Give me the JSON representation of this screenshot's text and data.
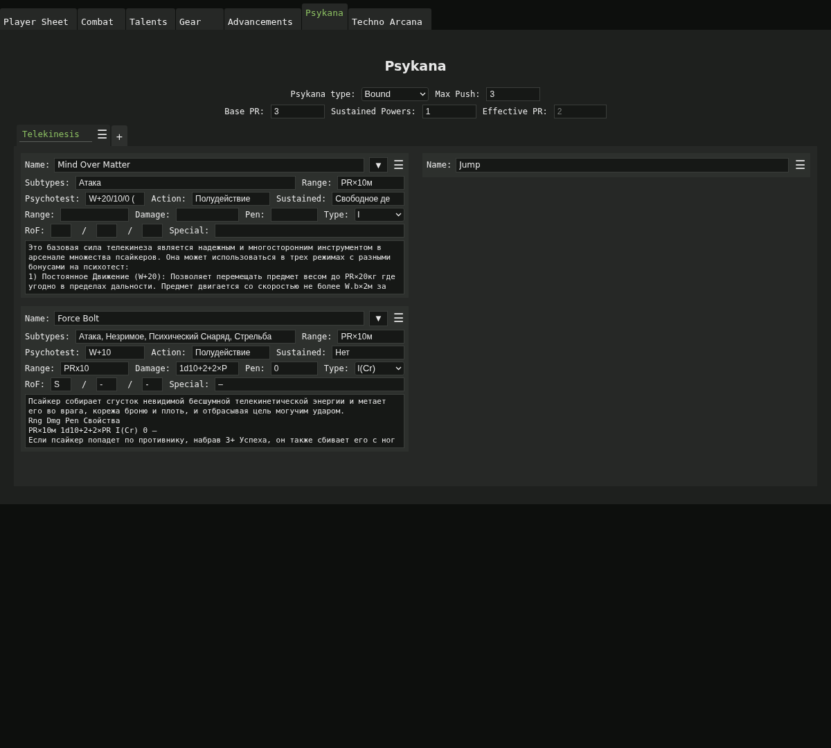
{
  "tabs": [
    {
      "label": "Player Sheet",
      "selected": false
    },
    {
      "label": "Combat",
      "selected": false
    },
    {
      "label": "Talents",
      "selected": false
    },
    {
      "label": "Gear",
      "selected": false
    },
    {
      "label": "Advancements",
      "selected": false
    },
    {
      "label": "Psykana",
      "selected": true
    },
    {
      "label": "Techno Arcana",
      "selected": false
    }
  ],
  "title": "Psykana",
  "settings": [
    [
      {
        "kind": "select",
        "label": "Psykana type:",
        "value": "Bound"
      },
      {
        "kind": "text",
        "label": "Max Push:",
        "value": "3"
      }
    ],
    [
      {
        "kind": "text",
        "label": "Base PR:",
        "value": "3"
      },
      {
        "kind": "text",
        "label": "Sustained Powers:",
        "value": "1"
      },
      {
        "kind": "text",
        "label": "Effective PR:",
        "value": "2",
        "disabled": true
      }
    ]
  ],
  "discipline_tabs": [
    {
      "label": "Telekinesis",
      "selected": true,
      "menu": "☰"
    }
  ],
  "add_tab": "+",
  "columns": [
    {
      "powers": [
        {
          "kind": "full",
          "name_label": "Name:",
          "name": "Mind Over Matter",
          "dropdown": "▼",
          "menu": "☰",
          "rows": [
            {
              "fields": [
                {
                  "kind": "text",
                  "label": "Subtypes:",
                  "value": "Атака"
                },
                {
                  "kind": "text",
                  "label": "Range:",
                  "value": "PR×10м"
                }
              ]
            },
            {
              "fields": [
                {
                  "kind": "text",
                  "label": "Psychotest:",
                  "value": "W+20/10/0 ("
                },
                {
                  "kind": "text",
                  "label": "Action:",
                  "value": "Полудействие"
                },
                {
                  "kind": "text",
                  "label": "Sustained:",
                  "value": "Свободное де"
                }
              ]
            },
            {
              "fields": [
                {
                  "kind": "text",
                  "label": "Range:"
                },
                {
                  "kind": "text",
                  "label": "Damage:"
                },
                {
                  "kind": "text",
                  "label": "Pen:"
                },
                {
                  "kind": "select",
                  "label": "Type:",
                  "value": "I"
                }
              ]
            },
            {
              "fields": [
                {
                  "kind": "text",
                  "label": "RoF:"
                },
                {
                  "kind": "text",
                  "label": "/"
                },
                {
                  "kind": "text",
                  "label": "/"
                },
                {
                  "kind": "text",
                  "label": "Special:"
                }
              ]
            }
          ],
          "description": "Это базовая сила телекинеза является надежным и многосторонним инструментом в\nарсенале множества псайкеров. Она может использоваться в трех режимах с разными\nбонусами на психотест:\n1) Постоянное Движение (W+20): Позволяет перемещать предмет весом до PR×20кг где\nугодно в пределах дальности. Предмет двигается со скоростью не более W.b×2м за"
        },
        {
          "kind": "full",
          "name_label": "Name:",
          "name": "Force Bolt",
          "dropdown": "▼",
          "menu": "☰",
          "rows": [
            {
              "fields": [
                {
                  "kind": "text",
                  "label": "Subtypes:",
                  "value": "Атака, Незримое, Психический Снаряд, Стрельба"
                },
                {
                  "kind": "text",
                  "label": "Range:",
                  "value": "PR×10м"
                }
              ]
            },
            {
              "fields": [
                {
                  "kind": "text",
                  "label": "Psychotest:",
                  "value": "W+10"
                },
                {
                  "kind": "text",
                  "label": "Action:",
                  "value": "Полудействие"
                },
                {
                  "kind": "text",
                  "label": "Sustained:",
                  "value": "Нет"
                }
              ]
            },
            {
              "fields": [
                {
                  "kind": "text",
                  "label": "Range:",
                  "value": "PRx10"
                },
                {
                  "kind": "text",
                  "label": "Damage:",
                  "value": "1d10+2+2×P"
                },
                {
                  "kind": "text",
                  "label": "Pen:",
                  "value": "0"
                },
                {
                  "kind": "select",
                  "label": "Type:",
                  "value": "I(Cr)"
                }
              ]
            },
            {
              "fields": [
                {
                  "kind": "text",
                  "label": "RoF:",
                  "value": "S"
                },
                {
                  "kind": "text",
                  "label": "/",
                  "value": "-"
                },
                {
                  "kind": "text",
                  "label": "/",
                  "value": "-"
                },
                {
                  "kind": "text",
                  "label": "Special:",
                  "value": "–"
                }
              ]
            }
          ],
          "description": "Псайкер собирает сгусток невидимой бесшумной телекинетической энергии и метает\nего во врага, корежа броню и плоть, и отбрасывая цель могучим ударом.\nRng Dmg Pen Свойства\nPR×10м 1d10+2+2×PR I(Cr) 0 –\nЕсли псайкер попадет по противнику, набрав 3+ Успеха, он также сбивает его с ног"
        }
      ]
    },
    {
      "powers": [
        {
          "kind": "collapsed",
          "name_label": "Name:",
          "name": "Jump",
          "menu": "☰"
        }
      ]
    }
  ]
}
